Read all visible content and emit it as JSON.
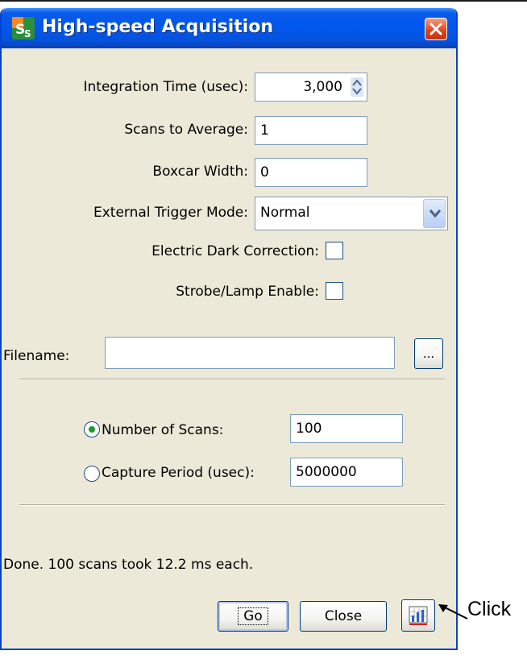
{
  "window": {
    "title": "High-speed Acquisition",
    "icon": "spectrasuite-app-icon",
    "close_icon": "close-icon"
  },
  "form": {
    "integration_time_label": "Integration Time (usec):",
    "integration_time_value": "3,000",
    "scans_to_average_label": "Scans to Average:",
    "scans_to_average_value": "1",
    "boxcar_width_label": "Boxcar Width:",
    "boxcar_width_value": "0",
    "trigger_mode_label": "External Trigger Mode:",
    "trigger_mode_value": "Normal",
    "dark_correction_label": "Electric Dark Correction:",
    "dark_correction_checked": false,
    "strobe_label": "Strobe/Lamp Enable:",
    "strobe_checked": false
  },
  "file": {
    "filename_label": "Filename:",
    "filename_value": "",
    "browse_label": "..."
  },
  "capture": {
    "number_of_scans_label": "Number of Scans:",
    "number_of_scans_value": "100",
    "number_of_scans_selected": true,
    "capture_period_label": "Capture Period (usec):",
    "capture_period_value": "5000000",
    "capture_period_selected": false
  },
  "status": {
    "message": "Done. 100 scans took 12.2 ms each."
  },
  "buttons": {
    "go": "Go",
    "close": "Close",
    "chart_icon": "chart-export-icon"
  },
  "annotation": {
    "text": "Click"
  },
  "colors": {
    "titlebar": "#0058ee",
    "window_bg": "#ece9d8",
    "field_border": "#7f9db9",
    "close_button": "#e2471e",
    "radio_selected": "#1e9a2a"
  }
}
